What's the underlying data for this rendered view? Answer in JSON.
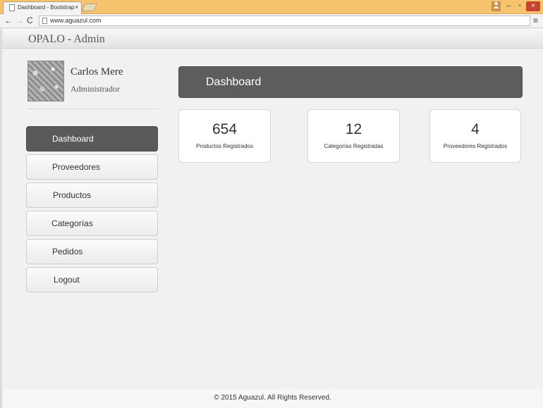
{
  "browser": {
    "tab_title": "Dashboard - Bootstrap Ad",
    "tab_close": "×",
    "url": "www.aguazul.com",
    "back": "←",
    "forward": "→",
    "reload": "C",
    "menu": "≡",
    "win_min": "–",
    "win_max": "▫",
    "win_close": "×"
  },
  "header": {
    "brand": "OPALO - Admin"
  },
  "profile": {
    "name": "Carlos Mere",
    "role": "Administrador"
  },
  "sidebar": {
    "items": [
      {
        "label": "Dashboard",
        "active": true
      },
      {
        "label": "Proveedores"
      },
      {
        "label": "Productos"
      },
      {
        "label": "Categorías"
      },
      {
        "label": "Pedidos"
      },
      {
        "label": "Logout"
      }
    ]
  },
  "main": {
    "title": "Dashboard",
    "stats": [
      {
        "value": "654",
        "label": "Productos Registrados"
      },
      {
        "value": "12",
        "label": "Categorías Registradas"
      },
      {
        "value": "4",
        "label": "Proveedores Registrados"
      }
    ]
  },
  "footer": {
    "text": "© 2015 Aguazul. All Rights Reserved."
  },
  "colors": {
    "accent": "#5d5d5d",
    "titlebar": "#f6c46e",
    "close": "#c8432f"
  }
}
